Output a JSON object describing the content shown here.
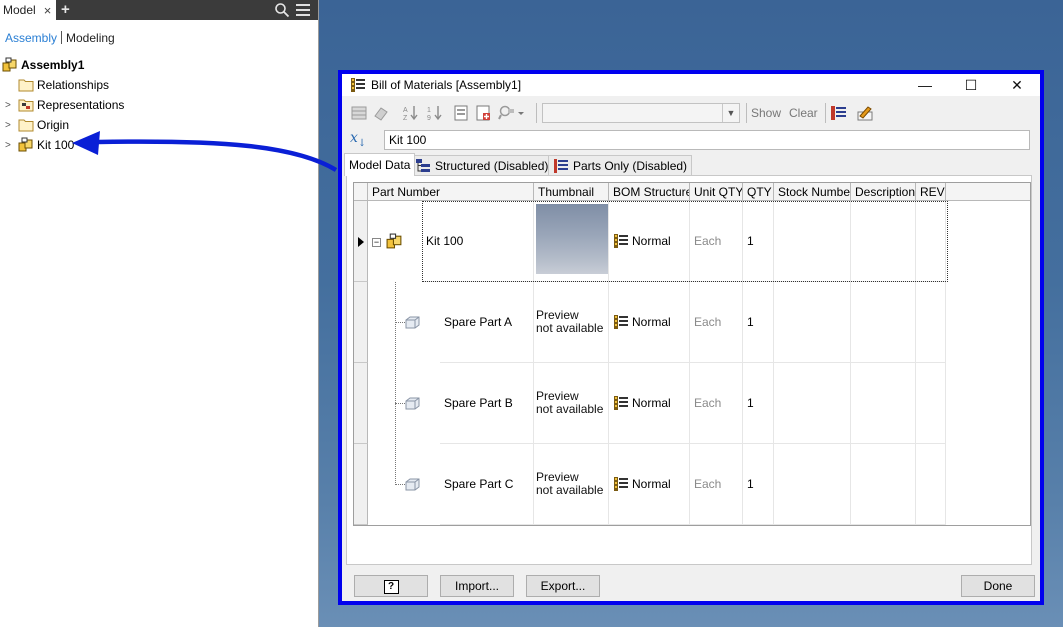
{
  "browser": {
    "tab_label": "Model",
    "close_glyph": "×",
    "add_glyph": "+",
    "switch": {
      "assembly": "Assembly",
      "modeling": "Modeling"
    },
    "tree": [
      {
        "label": "Assembly1",
        "icon": "assembly-icon",
        "bold": true
      },
      {
        "label": "Relationships",
        "icon": "folder-icon"
      },
      {
        "label": "Representations",
        "icon": "representations-icon",
        "expandable": true
      },
      {
        "label": "Origin",
        "icon": "folder-icon",
        "expandable": true
      },
      {
        "label": "Kit 100",
        "icon": "subassembly-icon",
        "expandable": true
      }
    ]
  },
  "dialog": {
    "title": "Bill of Materials [Assembly1]",
    "window_controls": {
      "minimize": "—",
      "maximize": "☐",
      "close": "✕"
    },
    "toolbar": {
      "combo_value": "",
      "show_label": "Show",
      "clear_label": "Clear"
    },
    "filter_value": "Kit 100",
    "fx_label": "x",
    "tabs": [
      {
        "label": "Model Data",
        "active": true
      },
      {
        "label": "Structured (Disabled)"
      },
      {
        "label": "Parts Only (Disabled)"
      }
    ],
    "columns": [
      "Part Number",
      "Thumbnail",
      "BOM Structure",
      "Unit QTY",
      "QTY",
      "Stock Number",
      "Description",
      "REV"
    ],
    "rows": [
      {
        "part_number": "Kit 100",
        "thumbnail": "image",
        "bom_structure": "Normal",
        "unit_qty": "Each",
        "qty": "1",
        "stock_number": "",
        "description": "",
        "rev": ""
      },
      {
        "part_number": "Spare Part A",
        "thumbnail_line1": "Preview",
        "thumbnail_line2": "not available",
        "bom_structure": "Normal",
        "unit_qty": "Each",
        "qty": "1",
        "stock_number": "",
        "description": "",
        "rev": ""
      },
      {
        "part_number": "Spare Part B",
        "thumbnail_line1": "Preview",
        "thumbnail_line2": "not available",
        "bom_structure": "Normal",
        "unit_qty": "Each",
        "qty": "1",
        "stock_number": "",
        "description": "",
        "rev": ""
      },
      {
        "part_number": "Spare Part C",
        "thumbnail_line1": "Preview",
        "thumbnail_line2": "not available",
        "bom_structure": "Normal",
        "unit_qty": "Each",
        "qty": "1",
        "stock_number": "",
        "description": "",
        "rev": ""
      }
    ],
    "footer": {
      "help_label": "?",
      "import_label": "Import...",
      "export_label": "Export...",
      "done_label": "Done"
    }
  },
  "colors": {
    "highlight_border": "#0000ee",
    "annotation_arrow": "#0a1fd6",
    "assembly_link": "#2a7fd4"
  }
}
